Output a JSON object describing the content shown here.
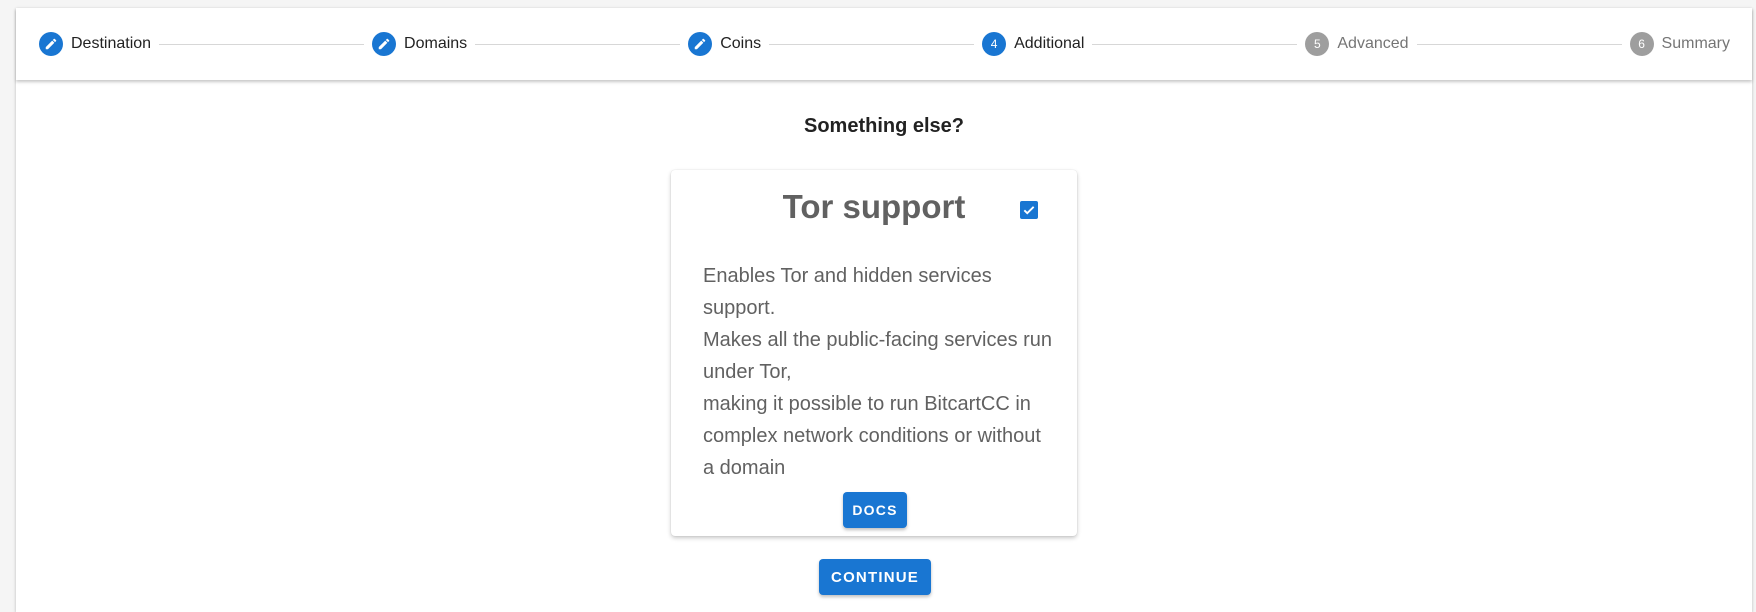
{
  "stepper": {
    "steps": [
      {
        "label": "Destination",
        "marker": "",
        "state": "done",
        "icon": "pencil-icon"
      },
      {
        "label": "Domains",
        "marker": "",
        "state": "done",
        "icon": "pencil-icon"
      },
      {
        "label": "Coins",
        "marker": "",
        "state": "done",
        "icon": "pencil-icon"
      },
      {
        "label": "Additional",
        "marker": "4",
        "state": "active"
      },
      {
        "label": "Advanced",
        "marker": "5",
        "state": "pending"
      },
      {
        "label": "Summary",
        "marker": "6",
        "state": "pending"
      }
    ]
  },
  "main": {
    "title": "Something else?",
    "card": {
      "title": "Tor support",
      "checked": true,
      "description": [
        "Enables Tor and hidden services support.",
        "Makes all the public-facing services run under Tor,",
        "making it possible to run BitcartCC in complex network conditions or without a domain"
      ],
      "docs_label": "Docs"
    },
    "continue_label": "Continue"
  },
  "colors": {
    "primary": "#1976d2",
    "pending": "#9e9e9e",
    "card_text": "#616161"
  }
}
